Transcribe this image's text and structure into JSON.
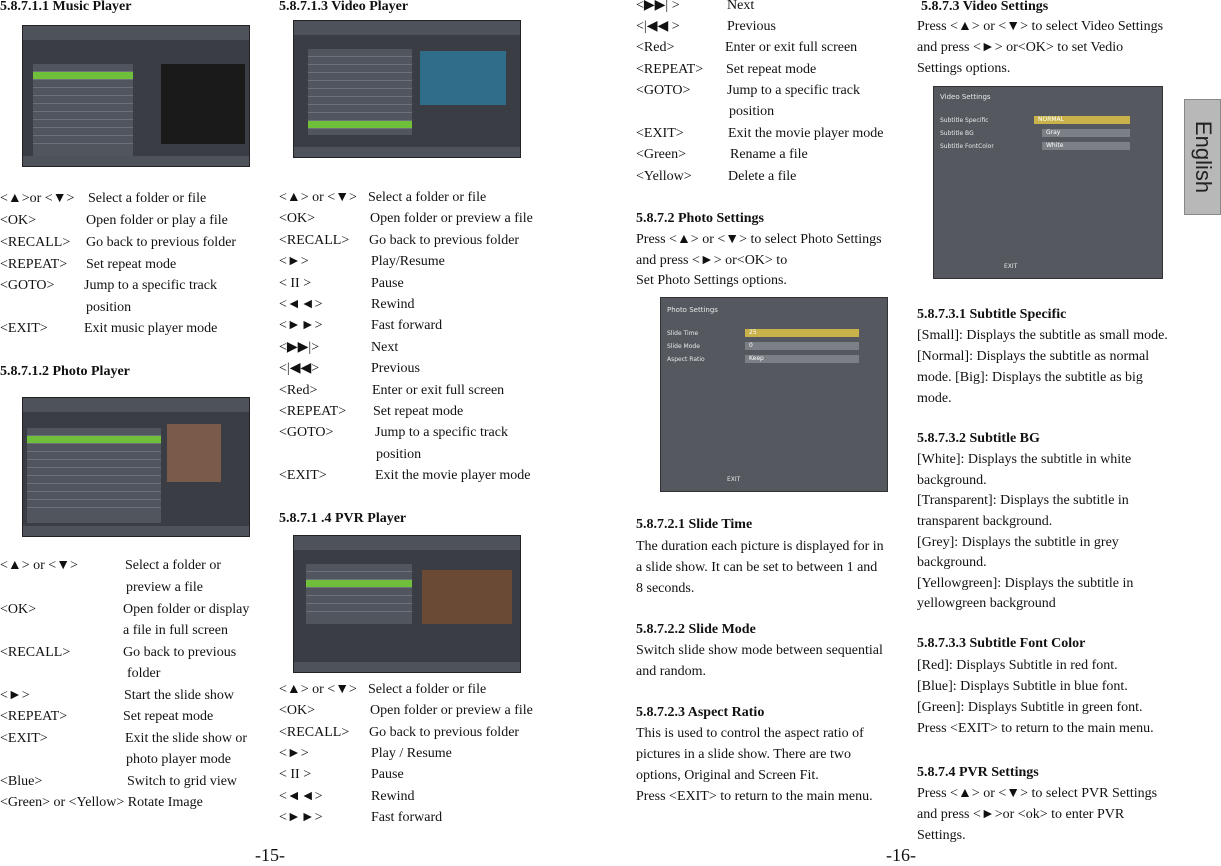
{
  "pages": {
    "left": "-15-",
    "right": "-16-"
  },
  "side_tab": "English",
  "music": {
    "heading": "5.8.7.1.1 Music Player",
    "rows": [
      {
        "k": "<▲>or <▼>",
        "v": "Select a folder or file"
      },
      {
        "k": "<OK>",
        "v": "Open folder or play a file"
      },
      {
        "k": "<RECALL>",
        "v": "Go back to previous folder"
      },
      {
        "k": "<REPEAT>",
        "v": "Set repeat mode"
      },
      {
        "k": "<GOTO>",
        "v": "Jump to a specific track"
      },
      {
        "k": "",
        "v": "position"
      },
      {
        "k": "<EXIT>",
        "v": "Exit music player mode"
      }
    ]
  },
  "photo": {
    "heading": "5.8.7.1.2 Photo Player",
    "rows": [
      {
        "k": "<▲> or <▼>",
        "v": "Select a folder or"
      },
      {
        "k": "",
        "v": "preview a file"
      },
      {
        "k": "<OK>",
        "v": "Open folder or display"
      },
      {
        "k": "",
        "v": "a file in full screen"
      },
      {
        "k": "<RECALL>",
        "v": "Go back to previous"
      },
      {
        "k": "",
        "v": "folder"
      },
      {
        "k": "<►>",
        "v": "Start the slide show"
      },
      {
        "k": "<REPEAT>",
        "v": "Set repeat mode"
      },
      {
        "k": "<EXIT>",
        "v": "Exit the slide show or"
      },
      {
        "k": "",
        "v": "photo player mode"
      },
      {
        "k": "<Blue>",
        "v": "Switch to grid view"
      },
      {
        "k": "<Green> or <Yellow> Rotate Image",
        "v": ""
      }
    ]
  },
  "video": {
    "heading": "5.8.7.1.3  Video Player",
    "rows": [
      {
        "k": "<▲> or <▼>",
        "v": "Select a folder or file"
      },
      {
        "k": "<OK>",
        "v": "Open folder or preview a file"
      },
      {
        "k": "<RECALL>",
        "v": "Go back to previous folder"
      },
      {
        "k": "<►>",
        "v": "Play/Resume"
      },
      {
        "k": "< II >",
        "v": "Pause"
      },
      {
        "k": "<◄◄>",
        "v": "Rewind"
      },
      {
        "k": "<►►>",
        "v": "Fast forward"
      },
      {
        "k": "<▶▶|>",
        "v": "Next"
      },
      {
        "k": "<|◀◀>",
        "v": "Previous"
      },
      {
        "k": "<Red>",
        "v": "Enter or exit full screen"
      },
      {
        "k": "<REPEAT>",
        "v": "Set repeat mode"
      },
      {
        "k": "<GOTO>",
        "v": "Jump to a specific track"
      },
      {
        "k": "",
        "v": "position"
      },
      {
        "k": "<EXIT>",
        "v": "Exit the movie player mode"
      }
    ]
  },
  "pvr": {
    "heading": "5.8.7.1 .4  PVR Player",
    "rows": [
      {
        "k": "<▲> or <▼>",
        "v": "Select a folder or file"
      },
      {
        "k": "<OK>",
        "v": "Open folder or preview a file"
      },
      {
        "k": "<RECALL>",
        "v": "Go back to previous folder"
      },
      {
        "k": "<►>",
        "v": "Play / Resume"
      },
      {
        "k": "< II >",
        "v": "Pause"
      },
      {
        "k": "<◄◄>",
        "v": "Rewind"
      },
      {
        "k": "<►►>",
        "v": "Fast forward"
      }
    ]
  },
  "pvr_cont": {
    "rows": [
      {
        "k": "<▶▶| >",
        "v": "Next"
      },
      {
        "k": "<|◀◀ >",
        "v": "Previous"
      },
      {
        "k": "<Red>",
        "v": "Enter or exit full screen"
      },
      {
        "k": "<REPEAT>",
        "v": "Set repeat mode"
      },
      {
        "k": "<GOTO>",
        "v": "Jump to a specific track"
      },
      {
        "k": "",
        "v": "position"
      },
      {
        "k": "<EXIT>",
        "v": "Exit the movie player mode"
      },
      {
        "k": "<Green>",
        "v": "Rename a file"
      },
      {
        "k": "<Yellow>",
        "v": "Delete a file"
      }
    ]
  },
  "photo_settings": {
    "heading": "5.8.7.2 Photo Settings",
    "p1": "Press <▲> or <▼> to select Photo Settings",
    "p2": "and press <►> or<OK> to",
    "p3": "Set Photo Settings options.",
    "screen": {
      "title": "Photo Settings",
      "labels": [
        "Slide Time",
        "Slide Mode",
        "Aspect Ratio"
      ],
      "values": [
        "25",
        "0",
        "Keep"
      ],
      "footer": "EXIT"
    }
  },
  "slide_time": {
    "heading": "5.8.7.2.1 Slide Time",
    "lines": [
      "The duration each picture is displayed for in",
      "a slide show. It can be set to between 1 and",
      "8 seconds."
    ]
  },
  "slide_mode": {
    "heading": "5.8.7.2.2 Slide Mode",
    "lines": [
      "Switch slide show mode between sequential",
      "and random."
    ]
  },
  "aspect_ratio": {
    "heading": "5.8.7.2.3 Aspect Ratio",
    "lines": [
      "This is used to control the aspect ratio of",
      "pictures in a slide show. There are two",
      "options, Original and Screen Fit.",
      "Press <EXIT> to return to the main menu."
    ]
  },
  "video_settings": {
    "heading": "5.8.7.3 Video Settings",
    "lines": [
      "Press <▲> or <▼> to select Video Settings",
      "and press <►> or<OK> to set Vedio",
      "Settings options."
    ],
    "screen": {
      "title": "Video Settings",
      "labels": [
        "Subtitle Specific",
        "Subtitle BG",
        "Subtitle FontColor"
      ],
      "values": [
        "NORMAL",
        "Gray",
        "White"
      ],
      "footer": "EXIT"
    }
  },
  "subtitle_specific": {
    "heading": "5.8.7.3.1 Subtitle Specific",
    "lines": [
      "[Small]: Displays the subtitle as small mode.",
      "[Normal]: Displays the subtitle as normal",
      "mode. [Big]: Displays the subtitle as big",
      "mode."
    ]
  },
  "subtitle_bg": {
    "heading": "5.8.7.3.2 Subtitle BG",
    "lines": [
      "[White]: Displays the subtitle in white",
      "background.",
      "[Transparent]: Displays the subtitle in",
      "transparent background.",
      "[Grey]: Displays the subtitle in grey",
      "background.",
      "[Yellowgreen]: Displays the subtitle in",
      "yellowgreen background"
    ]
  },
  "subtitle_font": {
    "heading": "5.8.7.3.3 Subtitle Font Color",
    "lines": [
      "[Red]: Displays Subtitle in red font.",
      "[Blue]: Displays Subtitle in blue font.",
      "[Green]: Displays Subtitle in green font.",
      "Press <EXIT> to return to the main menu."
    ]
  },
  "pvr_settings": {
    "heading": "5.8.7.4 PVR Settings",
    "lines": [
      "Press <▲> or <▼> to select PVR Settings",
      "and press <►>or <ok>  to enter PVR",
      "Settings."
    ]
  }
}
